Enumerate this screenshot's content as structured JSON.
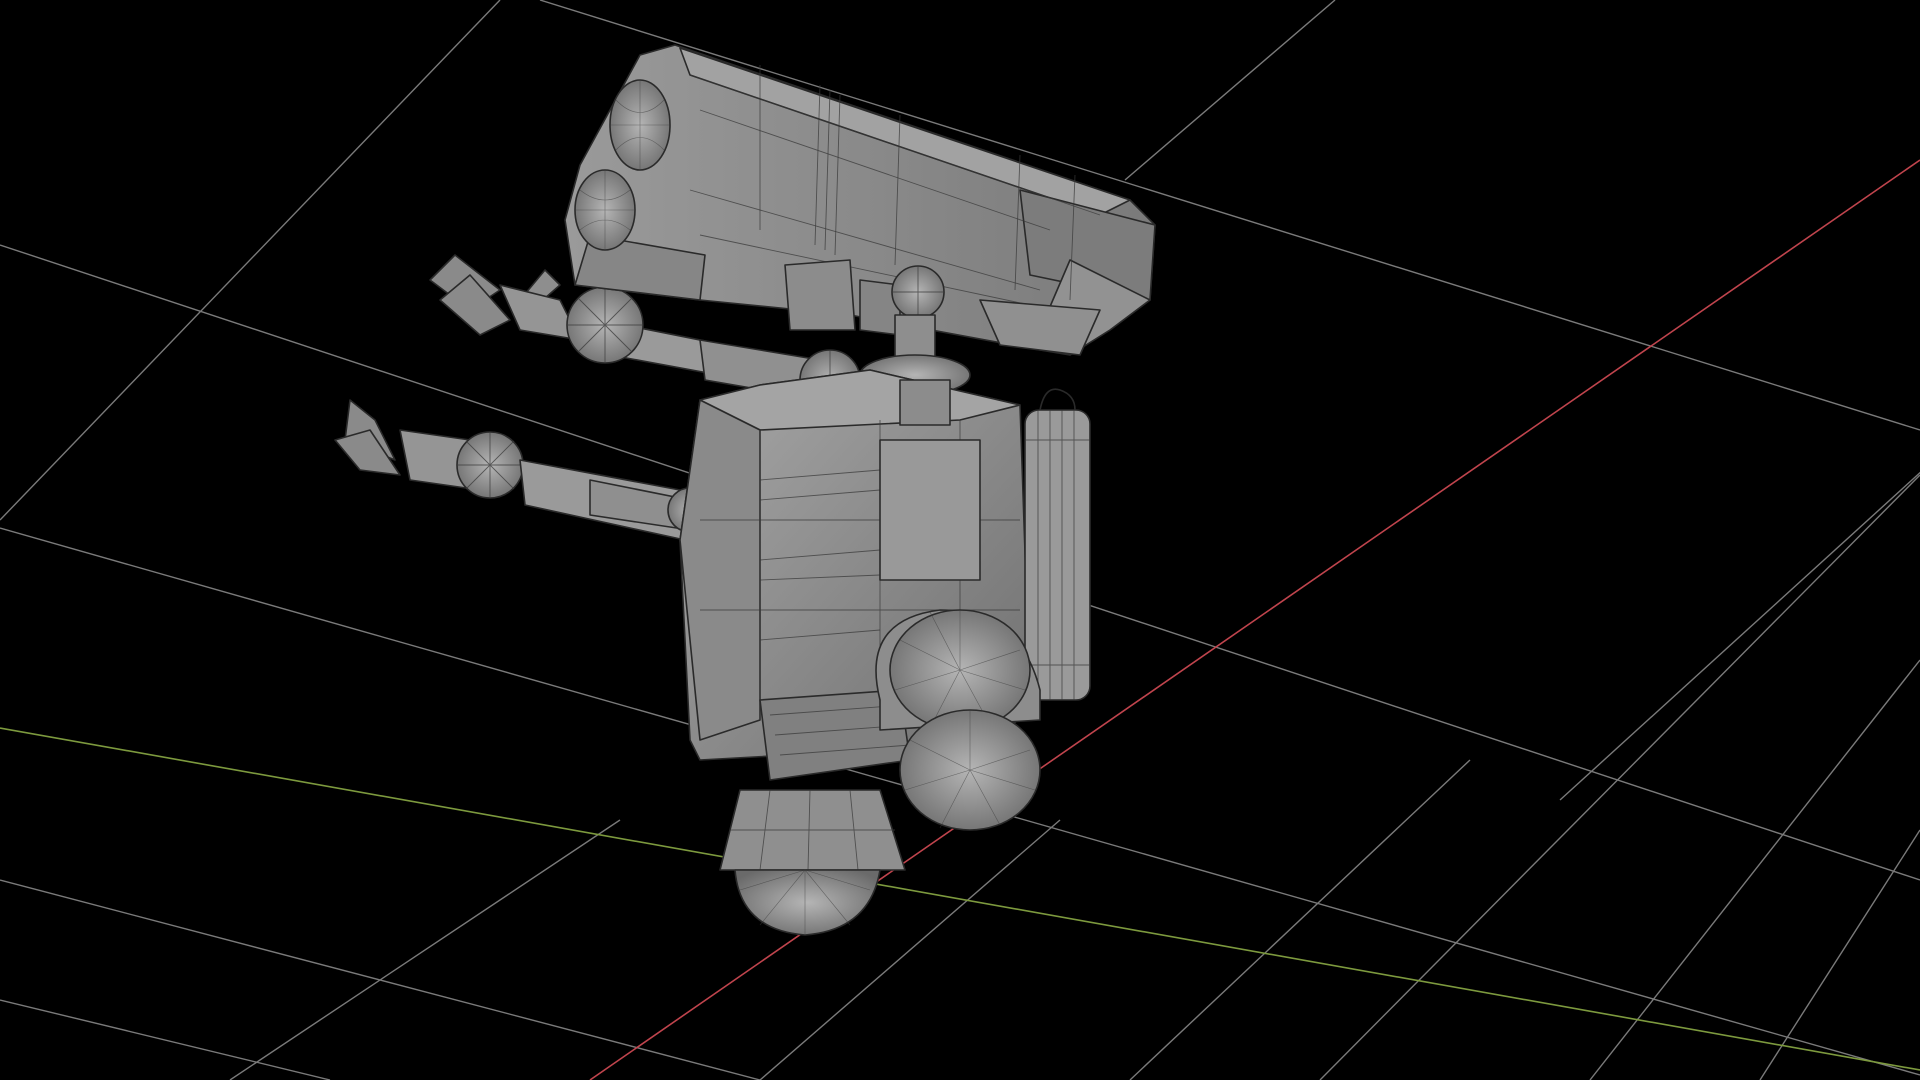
{
  "viewport": {
    "background": "#000000",
    "grid_color": "#7a7a7a",
    "x_axis_color": "#c0444d",
    "y_axis_color": "#7d9a3e",
    "mesh_color": "#8c8c8c",
    "wire_color": "#2a2a2a",
    "object": "robot-mesh"
  }
}
